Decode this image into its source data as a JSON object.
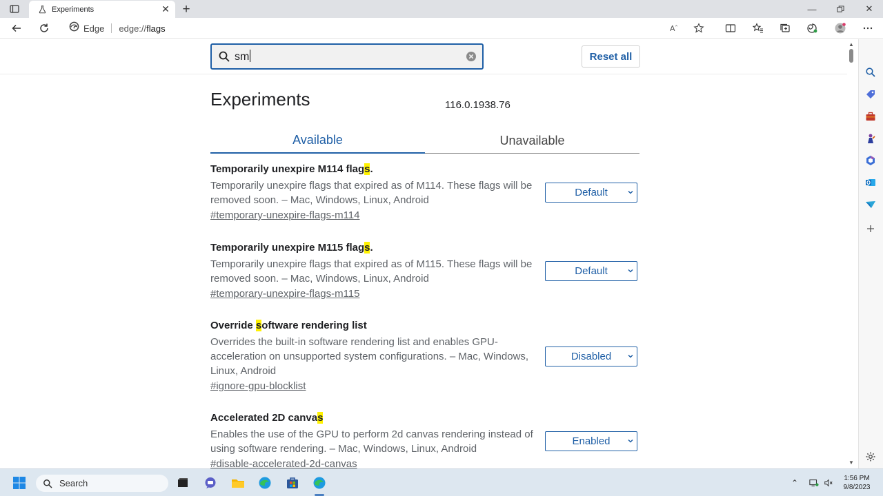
{
  "browser": {
    "tab_title": "Experiments",
    "address_prefix": "Edge",
    "url_scheme": "edge://",
    "url_path": "flags"
  },
  "search": {
    "value": "sm"
  },
  "reset_all_label": "Reset all",
  "page_title": "Experiments",
  "version": "116.0.1938.76",
  "tabs": {
    "available": "Available",
    "unavailable": "Unavailable"
  },
  "flags": [
    {
      "title_pre": "Temporarily unexpire M114 flag",
      "title_hl": "s",
      "title_post": ".",
      "description": "Temporarily unexpire flags that expired as of M114. These flags will be removed soon. – Mac, Windows, Linux, Android",
      "link": "#temporary-unexpire-flags-m114",
      "value": "Default"
    },
    {
      "title_pre": "Temporarily unexpire M115 flag",
      "title_hl": "s",
      "title_post": ".",
      "description": "Temporarily unexpire flags that expired as of M115. These flags will be removed soon. – Mac, Windows, Linux, Android",
      "link": "#temporary-unexpire-flags-m115",
      "value": "Default"
    },
    {
      "title_pre": "Override ",
      "title_hl": "s",
      "title_post": "oftware rendering list",
      "description": "Overrides the built-in software rendering list and enables GPU-acceleration on unsupported system configurations. – Mac, Windows, Linux, Android",
      "link": "#ignore-gpu-blocklist",
      "value": "Disabled"
    },
    {
      "title_pre": "Accelerated 2D canva",
      "title_hl": "s",
      "title_post": "",
      "description": "Enables the use of the GPU to perform 2d canvas rendering instead of using software rendering. – Mac, Windows, Linux, Android",
      "link": "#disable-accelerated-2d-canvas",
      "value": "Enabled"
    }
  ],
  "taskbar": {
    "search_label": "Search",
    "time": "1:56 PM",
    "date": "9/8/2023"
  },
  "colors": {
    "accent": "#1f5fa6",
    "highlight": "#fff200"
  }
}
